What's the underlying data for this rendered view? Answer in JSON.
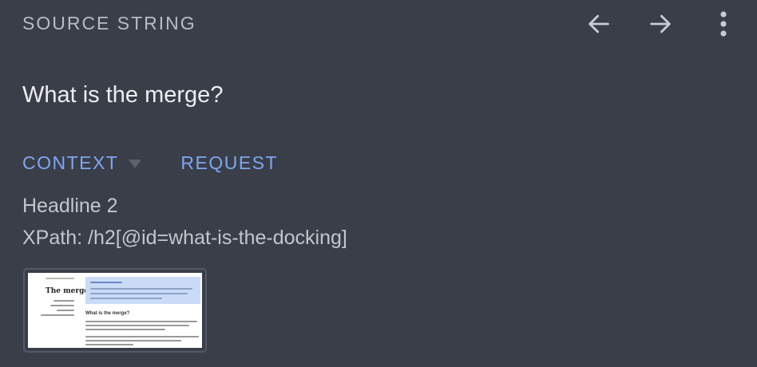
{
  "header": {
    "title": "SOURCE STRING",
    "back_icon": "arrow-left-icon",
    "forward_icon": "arrow-right-icon",
    "more_icon": "more-vert-icon"
  },
  "source": {
    "text": "What is the merge?"
  },
  "tabs": [
    {
      "label": "CONTEXT",
      "has_dropdown": true
    },
    {
      "label": "REQUEST",
      "has_dropdown": false
    }
  ],
  "context": {
    "type": "Headline 2",
    "xpath": "XPath: /h2[@id=what-is-the-docking]"
  },
  "screenshot": {
    "page_title": "The merge",
    "section_heading": "What is the merge?"
  },
  "colors": {
    "background": "#3a3e48",
    "accent": "#7ea6f2",
    "muted_text": "#b9bcc4",
    "primary_text": "#eceef1"
  }
}
